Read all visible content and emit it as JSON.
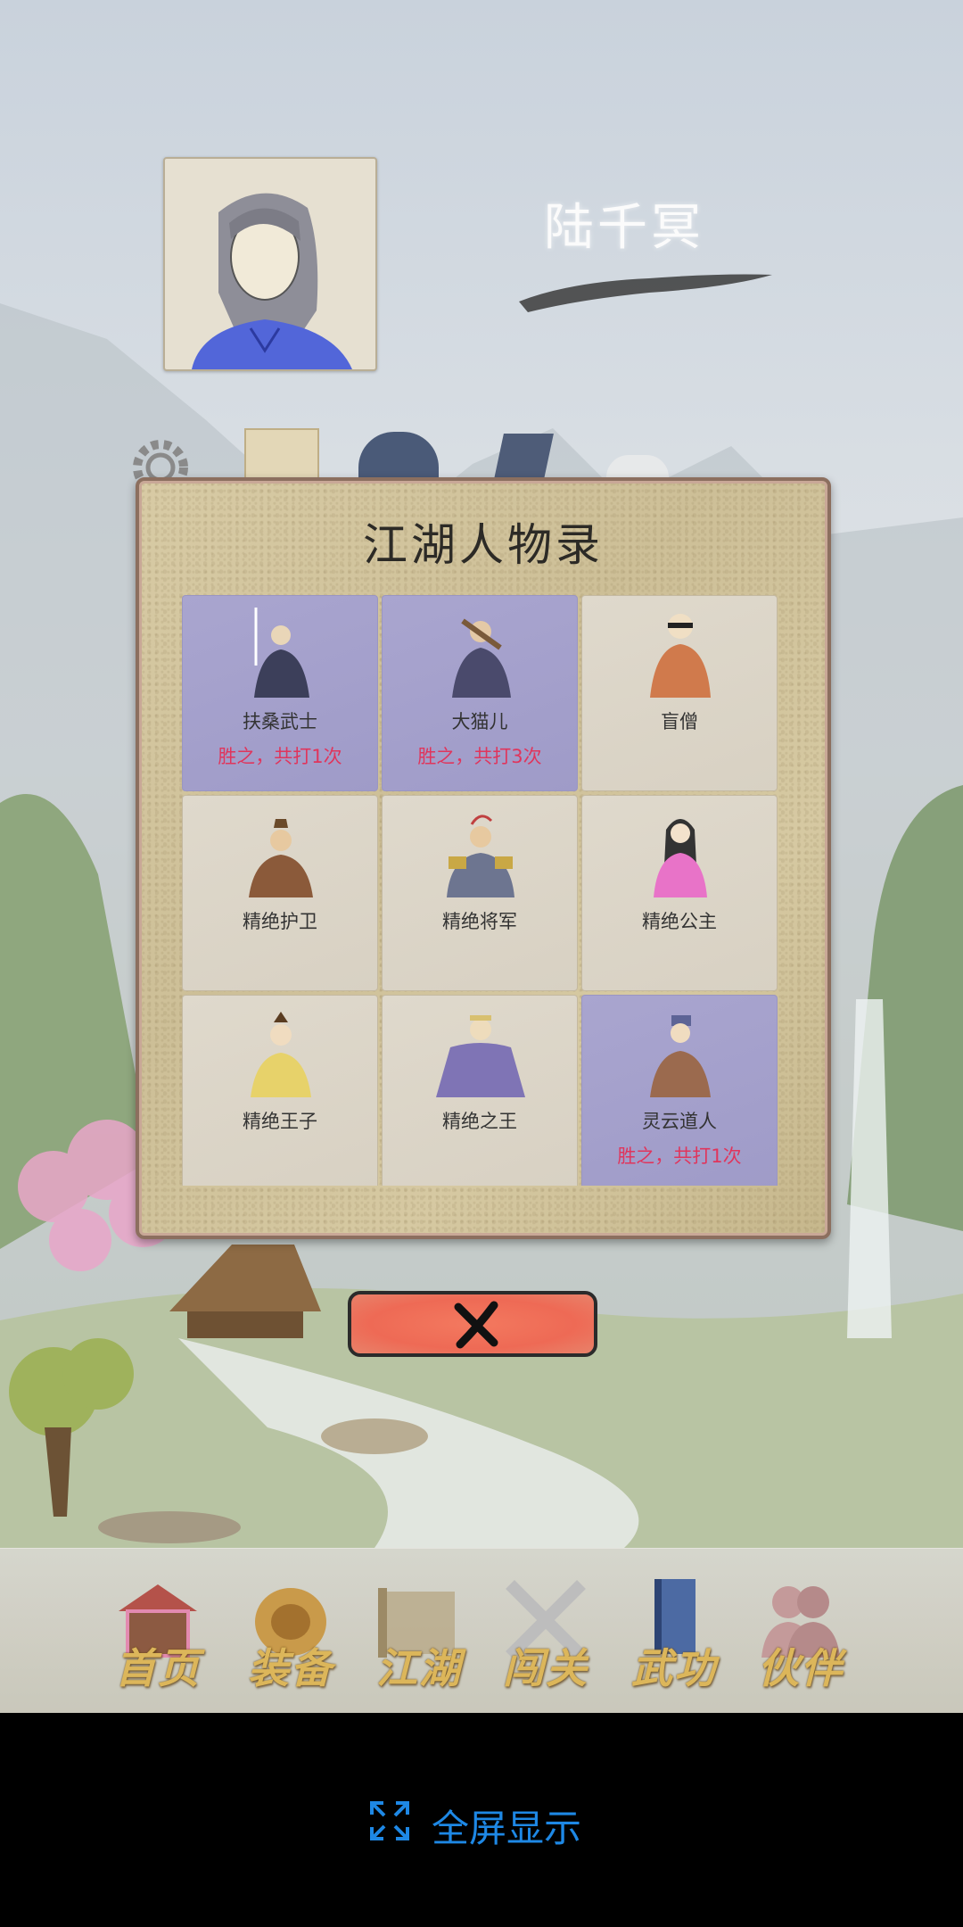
{
  "player": {
    "name": "陆千冥"
  },
  "top_icons": [
    "gear-icon",
    "scroll-icon",
    "vase-icon",
    "book-icon",
    "cloud-icon"
  ],
  "dialog": {
    "title": "江湖人物录",
    "characters": [
      {
        "name": "扶桑武士",
        "record": "胜之，共打1次",
        "beaten": true
      },
      {
        "name": "大猫儿",
        "record": "胜之，共打3次",
        "beaten": true
      },
      {
        "name": "盲僧",
        "record": "",
        "beaten": false
      },
      {
        "name": "精绝护卫",
        "record": "",
        "beaten": false
      },
      {
        "name": "精绝将军",
        "record": "",
        "beaten": false
      },
      {
        "name": "精绝公主",
        "record": "",
        "beaten": false
      },
      {
        "name": "精绝王子",
        "record": "",
        "beaten": false
      },
      {
        "name": "精绝之王",
        "record": "",
        "beaten": false
      },
      {
        "name": "灵云道人",
        "record": "胜之，共打1次",
        "beaten": true
      }
    ]
  },
  "nav": {
    "items": [
      {
        "label": "首页",
        "icon": "house-icon"
      },
      {
        "label": "装备",
        "icon": "armor-icon"
      },
      {
        "label": "江湖",
        "icon": "map-scroll-icon"
      },
      {
        "label": "闯关",
        "icon": "crossed-swords-icon"
      },
      {
        "label": "武功",
        "icon": "manual-book-icon"
      },
      {
        "label": "伙伴",
        "icon": "partners-icon"
      }
    ]
  },
  "system": {
    "fullscreen_label": "全屏显示"
  },
  "colors": {
    "beaten_cell": "#a9a5cf",
    "record_text": "#e0355c",
    "nav_label": "#dcb65a",
    "fullscreen_text": "#1e88e5"
  }
}
